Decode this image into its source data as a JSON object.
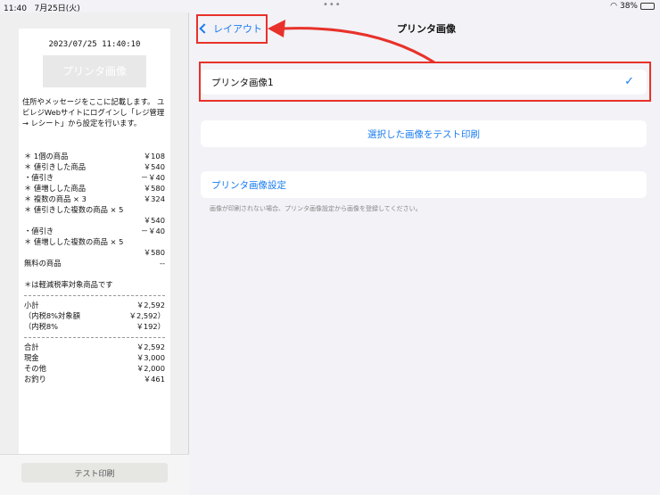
{
  "status": {
    "time": "11:40",
    "date": "7月25日(火)",
    "battery": "38%",
    "battery_level": 0.38
  },
  "receipt": {
    "datetime": "2023/07/25 11:40:10",
    "image_placeholder": "プリンタ画像",
    "message": "住所やメッセージをここに記載します。 ユビレジWebサイトにログインし「レジ管理 → レシート」から設定を行います。",
    "items": [
      {
        "label": "＊ 1個の商品",
        "value": "￥108"
      },
      {
        "label": "＊ 値引きした商品",
        "value": "￥540"
      },
      {
        "label": "・値引き",
        "value": "－￥40"
      },
      {
        "label": "＊ 値増しした商品",
        "value": "￥580"
      },
      {
        "label": "＊ 複数の商品 × 3",
        "value": "￥324"
      },
      {
        "label": "＊ 値引きした複数の商品 × 5",
        "value": ""
      },
      {
        "label": "",
        "value": "￥540"
      },
      {
        "label": "・値引き",
        "value": "－￥40"
      },
      {
        "label": "＊ 値増しした複数の商品 × 5",
        "value": ""
      },
      {
        "label": "",
        "value": "￥580"
      },
      {
        "label": "無料の商品",
        "value": "--"
      }
    ],
    "tax_note": "＊は軽減税率対象商品です",
    "subtotal": [
      {
        "label": "小計",
        "value": "￥2,592"
      },
      {
        "label": "（内税8%対象額",
        "value": "￥2,592）"
      },
      {
        "label": "（内税8%",
        "value": "￥192）"
      }
    ],
    "totals": [
      {
        "label": "合計",
        "value": "￥2,592"
      },
      {
        "label": "現金",
        "value": "￥3,000"
      },
      {
        "label": "その他",
        "value": "￥2,000"
      },
      {
        "label": "お釣り",
        "value": "￥461"
      }
    ],
    "test_print_label": "テスト印刷"
  },
  "nav": {
    "back_label": "レイアウト",
    "title": "プリンタ画像"
  },
  "main": {
    "selected_image": "プリンタ画像1",
    "check_icon": "✓",
    "test_print_selected": "選択した画像をテスト印刷",
    "printer_image_settings": "プリンタ画像設定",
    "footnote": "画像が印刷されない場合、プリンタ画像設定から画像を登録してください。"
  },
  "colors": {
    "accent": "#1a7cf0",
    "highlight": "#e8312a"
  }
}
